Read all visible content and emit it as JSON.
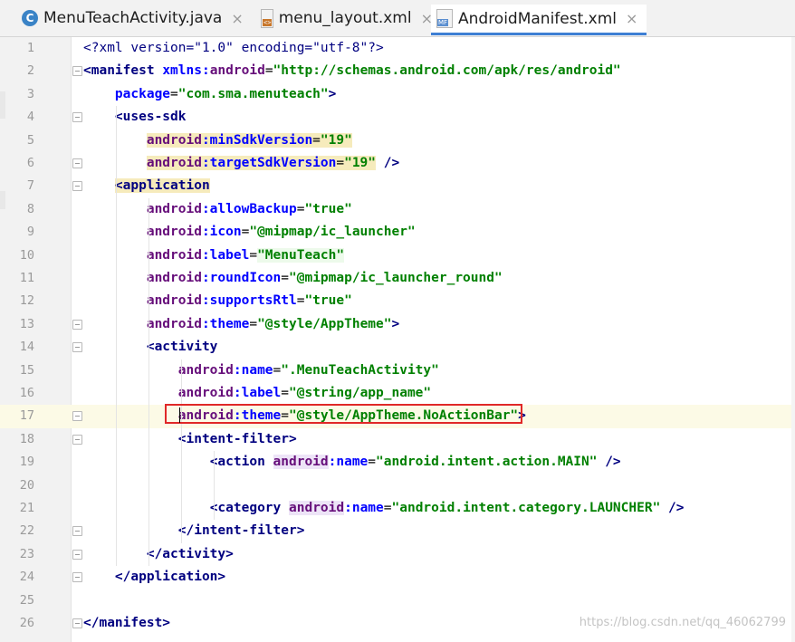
{
  "tabs": [
    {
      "label": "MenuTeachActivity.java",
      "icon": "java-class-icon",
      "active": false
    },
    {
      "label": "menu_layout.xml",
      "icon": "xml-file-icon",
      "active": false
    },
    {
      "label": "AndroidManifest.xml",
      "icon": "manifest-file-icon",
      "active": true
    }
  ],
  "tab_close_glyph": "×",
  "editor": {
    "current_line": 17,
    "lines": [
      {
        "n": "1",
        "segs": [
          [
            "",
            "<?xml version=\"1.0\" encoding=\"utf-8\"?>",
            "t-proc"
          ]
        ]
      },
      {
        "n": "2",
        "segs": [
          [
            "",
            "<manifest ",
            "t-tag"
          ],
          [
            "",
            "xmlns:",
            "t-attr"
          ],
          [
            "",
            "android",
            "t-ns"
          ],
          [
            "",
            "=",
            "t-plain"
          ],
          [
            "",
            "\"http://schemas.android.com/apk/res/android\"",
            "t-val"
          ]
        ]
      },
      {
        "n": "3",
        "segs": [
          [
            "    ",
            "package",
            "t-attr"
          ],
          [
            "",
            "=",
            "t-plain"
          ],
          [
            "",
            "\"com.sma.menuteach\"",
            "t-val"
          ],
          [
            "",
            ">",
            "t-tag"
          ]
        ]
      },
      {
        "n": "4",
        "segs": [
          [
            "    ",
            "<uses-sdk",
            "t-tag"
          ]
        ]
      },
      {
        "n": "5",
        "segs": [
          [
            "        ",
            "android",
            "t-ns hl-warn"
          ],
          [
            "",
            ":minSdkVersion",
            "t-attr hl-warn"
          ],
          [
            "",
            "=",
            "t-plain hl-warn"
          ],
          [
            "",
            "\"19\"",
            "t-val hl-warn"
          ]
        ]
      },
      {
        "n": "6",
        "segs": [
          [
            "        ",
            "android",
            "t-ns hl-warn"
          ],
          [
            "",
            ":targetSdkVersion",
            "t-attr hl-warn"
          ],
          [
            "",
            "=",
            "t-plain hl-warn"
          ],
          [
            "",
            "\"19\"",
            "t-val hl-warn"
          ],
          [
            "",
            " />",
            "t-tag"
          ]
        ]
      },
      {
        "n": "7",
        "segs": [
          [
            "    ",
            "<application",
            "t-tag hl-warn"
          ]
        ]
      },
      {
        "n": "8",
        "segs": [
          [
            "        ",
            "android",
            "t-ns"
          ],
          [
            "",
            ":allowBackup",
            "t-attr"
          ],
          [
            "",
            "=",
            "t-plain"
          ],
          [
            "",
            "\"true\"",
            "t-val"
          ]
        ]
      },
      {
        "n": "9",
        "segs": [
          [
            "        ",
            "android",
            "t-ns"
          ],
          [
            "",
            ":icon",
            "t-attr"
          ],
          [
            "",
            "=",
            "t-plain"
          ],
          [
            "",
            "\"@mipmap/ic_launcher\"",
            "t-val"
          ]
        ]
      },
      {
        "n": "10",
        "segs": [
          [
            "        ",
            "android",
            "t-ns"
          ],
          [
            "",
            ":label",
            "t-attr"
          ],
          [
            "",
            "=",
            "t-plain"
          ],
          [
            "",
            "\"MenuTeach\"",
            "t-val hl-green"
          ]
        ]
      },
      {
        "n": "11",
        "segs": [
          [
            "        ",
            "android",
            "t-ns"
          ],
          [
            "",
            ":roundIcon",
            "t-attr"
          ],
          [
            "",
            "=",
            "t-plain"
          ],
          [
            "",
            "\"@mipmap/ic_launcher_round\"",
            "t-val"
          ]
        ]
      },
      {
        "n": "12",
        "segs": [
          [
            "        ",
            "android",
            "t-ns"
          ],
          [
            "",
            ":supportsRtl",
            "t-attr"
          ],
          [
            "",
            "=",
            "t-plain"
          ],
          [
            "",
            "\"true\"",
            "t-val"
          ]
        ]
      },
      {
        "n": "13",
        "segs": [
          [
            "        ",
            "android",
            "t-ns"
          ],
          [
            "",
            ":theme",
            "t-attr"
          ],
          [
            "",
            "=",
            "t-plain"
          ],
          [
            "",
            "\"@style/AppTheme\"",
            "t-val"
          ],
          [
            "",
            ">",
            "t-tag"
          ]
        ]
      },
      {
        "n": "14",
        "segs": [
          [
            "        ",
            "<activity",
            "t-tag"
          ]
        ]
      },
      {
        "n": "15",
        "segs": [
          [
            "            ",
            "android",
            "t-ns"
          ],
          [
            "",
            ":name",
            "t-attr"
          ],
          [
            "",
            "=",
            "t-plain"
          ],
          [
            "",
            "\".MenuTeachActivity\"",
            "t-val"
          ]
        ]
      },
      {
        "n": "16",
        "segs": [
          [
            "            ",
            "android",
            "t-ns"
          ],
          [
            "",
            ":label",
            "t-attr"
          ],
          [
            "",
            "=",
            "t-plain"
          ],
          [
            "",
            "\"@string/app_name\"",
            "t-val"
          ]
        ]
      },
      {
        "n": "17",
        "segs": [
          [
            "            ",
            "android",
            "t-ns"
          ],
          [
            "",
            ":theme",
            "t-attr"
          ],
          [
            "",
            "=",
            "t-plain"
          ],
          [
            "",
            "\"@style/AppTheme.NoActionBar\"",
            "t-val"
          ],
          [
            "",
            ">",
            "t-tag"
          ]
        ]
      },
      {
        "n": "18",
        "segs": [
          [
            "            ",
            "<intent-filter>",
            "t-tag"
          ]
        ]
      },
      {
        "n": "19",
        "segs": [
          [
            "                ",
            "<action ",
            "t-tag"
          ],
          [
            "",
            "android",
            "t-ns hl-ns"
          ],
          [
            "",
            ":name",
            "t-attr"
          ],
          [
            "",
            "=",
            "t-plain"
          ],
          [
            "",
            "\"android.intent.action.MAIN\"",
            "t-val"
          ],
          [
            "",
            " />",
            "t-tag"
          ]
        ]
      },
      {
        "n": "20",
        "segs": []
      },
      {
        "n": "21",
        "segs": [
          [
            "                ",
            "<category ",
            "t-tag"
          ],
          [
            "",
            "android",
            "t-ns hl-ns"
          ],
          [
            "",
            ":name",
            "t-attr"
          ],
          [
            "",
            "=",
            "t-plain"
          ],
          [
            "",
            "\"android.intent.category.LAUNCHER\"",
            "t-val"
          ],
          [
            "",
            " />",
            "t-tag"
          ]
        ]
      },
      {
        "n": "22",
        "segs": [
          [
            "            ",
            "</intent-filter>",
            "t-tag"
          ]
        ]
      },
      {
        "n": "23",
        "segs": [
          [
            "        ",
            "</activity>",
            "t-tag"
          ]
        ]
      },
      {
        "n": "24",
        "segs": [
          [
            "    ",
            "</application>",
            "t-tag"
          ]
        ]
      },
      {
        "n": "25",
        "segs": []
      },
      {
        "n": "26",
        "segs": [
          [
            "",
            "</manifest>",
            "t-tag"
          ]
        ]
      }
    ]
  },
  "watermark": "https://blog.csdn.net/qq_46062799",
  "colors": {
    "annotation": "#e02828",
    "active_tab_underline": "#3e7fd4"
  }
}
